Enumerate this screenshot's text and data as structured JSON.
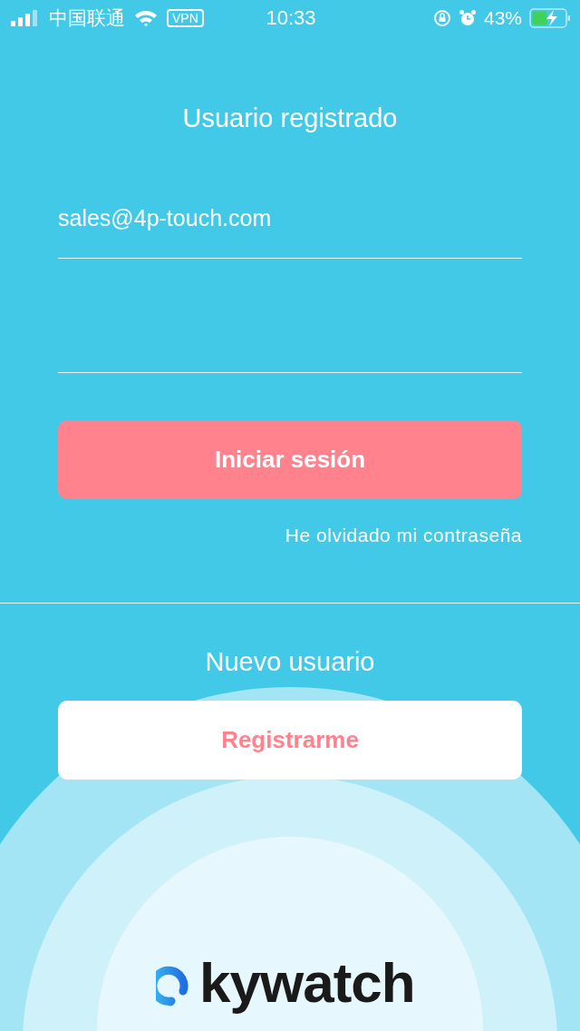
{
  "status_bar": {
    "carrier": "中国联通",
    "vpn": "VPN",
    "time": "10:33",
    "battery": "43%"
  },
  "login": {
    "title": "Usuario registrado",
    "email": "sales@4p-touch.com",
    "submit": "Iniciar sesión",
    "forgot": "He olvidado mi contraseña"
  },
  "signup": {
    "title": "Nuevo usuario",
    "button": "Registrarme"
  },
  "logo": {
    "text": "kywatch"
  }
}
